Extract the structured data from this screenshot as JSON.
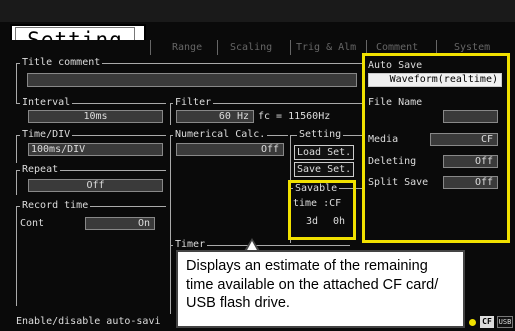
{
  "screen_title": "Setting",
  "tabs": [
    "Range",
    "Scaling",
    "Trig & Alm",
    "Comment",
    "System"
  ],
  "title_comment": {
    "label": "Title comment",
    "value": ""
  },
  "interval": {
    "label": "Interval",
    "value": "10ms"
  },
  "filter": {
    "label": "Filter",
    "value": "60 Hz",
    "fc": "fc = 11560Hz"
  },
  "time_div": {
    "label": "Time/DIV",
    "value": "100ms/DIV"
  },
  "numerical_calc": {
    "label": "Numerical Calc.",
    "value": "Off"
  },
  "setting_group": {
    "label": "Setting",
    "load": "Load Set.",
    "save": "Save Set."
  },
  "repeat": {
    "label": "Repeat",
    "value": "Off"
  },
  "record_time": {
    "label": "Record time",
    "cont_label": "Cont",
    "cont_value": "On"
  },
  "savable": {
    "line1": "Savable",
    "line2": "time :CF",
    "days": "3d",
    "hours": "0h"
  },
  "timer": {
    "label": "Timer"
  },
  "auto_save": {
    "label": "Auto Save",
    "value": "Waveform(realtime)",
    "file_name_label": "File Name",
    "file_name_value": "",
    "media_label": "Media",
    "media_value": "CF",
    "deleting_label": "Deleting",
    "deleting_value": "Off",
    "split_save_label": "Split Save",
    "split_save_value": "Off"
  },
  "status_bar": {
    "text": "Enable/disable auto-savi",
    "cf_badge": "CF",
    "usb_badge": "USB"
  },
  "callout": "Displays an estimate of the remaining time available on the attached CF card/ USB flash drive.",
  "colors": {
    "highlight": "#f1e100",
    "background": "#0a0a0a",
    "field": "#3a3a3a"
  }
}
